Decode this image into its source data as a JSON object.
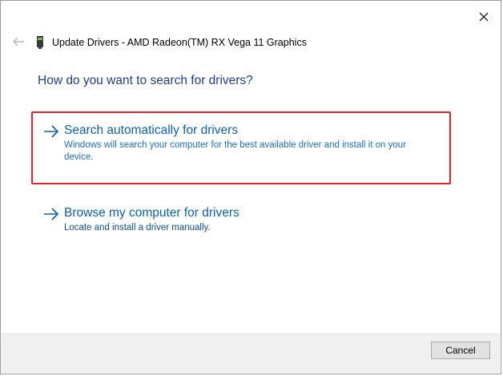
{
  "window": {
    "title": "Update Drivers - AMD Radeon(TM) RX Vega 11 Graphics"
  },
  "icons": {
    "close": "close-icon",
    "back": "back-arrow-icon",
    "device": "display-adapter-icon",
    "option_arrow": "arrow-right-icon"
  },
  "main": {
    "heading": "How do you want to search for drivers?",
    "options": [
      {
        "label": "Search automatically for drivers",
        "description": "Windows will search your computer for the best available driver and install it on your device.",
        "highlighted": true
      },
      {
        "label": "Browse my computer for drivers",
        "description": "Locate and install a driver manually.",
        "highlighted": false
      }
    ]
  },
  "footer": {
    "cancel_label": "Cancel"
  },
  "colors": {
    "heading": "#1e3f87",
    "link": "#0a5fb8",
    "highlight_border": "#e8232a",
    "footer_bg": "#f0f0f0"
  }
}
